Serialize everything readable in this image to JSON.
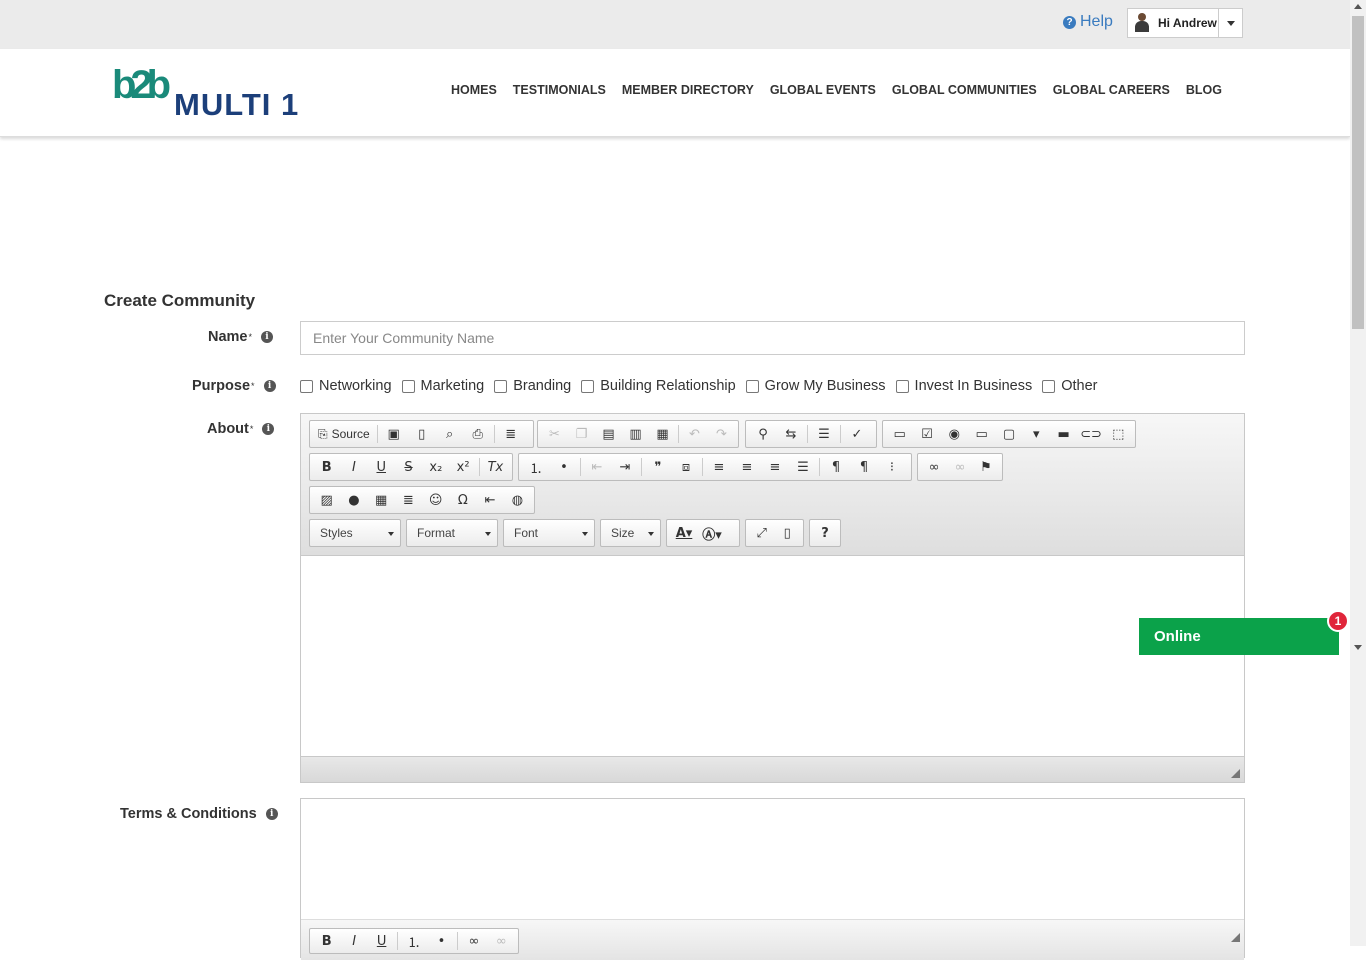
{
  "topbar": {
    "help_label": "Help",
    "user_label": "Hi Andrew"
  },
  "brand": {
    "logo_mark": "b2b",
    "logo_word": "MULTI 1"
  },
  "nav": [
    "HOMES",
    "TESTIMONIALS",
    "MEMBER DIRECTORY",
    "GLOBAL EVENTS",
    "GLOBAL COMMUNITIES",
    "GLOBAL CAREERS",
    "BLOG"
  ],
  "form": {
    "title": "Create Community",
    "name_label": "Name",
    "name_placeholder": "Enter Your Community Name",
    "purpose_label": "Purpose",
    "purposes": [
      "Networking",
      "Marketing",
      "Branding",
      "Building Relationship",
      "Grow My Business",
      "Invest In Business",
      "Other"
    ],
    "about_label": "About",
    "terms_label": "Terms & Conditions",
    "required_mark": "*"
  },
  "editor": {
    "source_label": "Source",
    "styles_label": "Styles",
    "format_label": "Format",
    "font_label": "Font",
    "size_label": "Size"
  },
  "chat": {
    "label": "Online",
    "count": "1"
  },
  "colors": {
    "nav_text": "#333333",
    "link_blue": "#3a7bbf",
    "online_green": "#0ba24a",
    "badge_red": "#e0253a",
    "logo_teal": "#1a8a7a",
    "logo_navy": "#1c3f7a"
  }
}
